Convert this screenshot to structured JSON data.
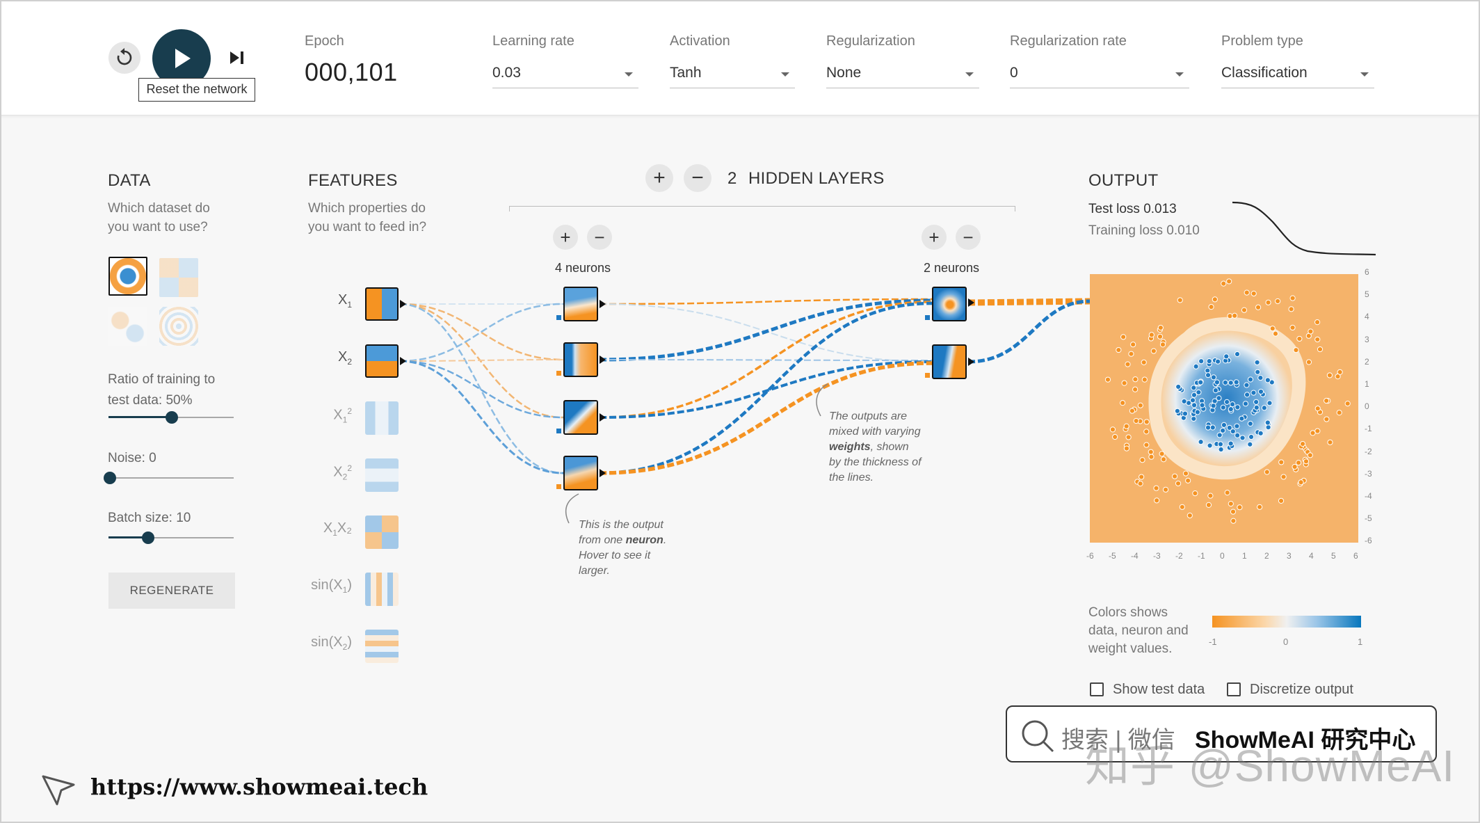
{
  "controls": {
    "reset_tooltip": "Reset the network",
    "reset_icon": "reset-icon",
    "play_icon": "play-icon",
    "step_icon": "step-icon"
  },
  "params": {
    "epoch_label": "Epoch",
    "epoch_value": "000,101",
    "learning_rate_label": "Learning rate",
    "learning_rate_value": "0.03",
    "activation_label": "Activation",
    "activation_value": "Tanh",
    "regularization_label": "Regularization",
    "regularization_value": "None",
    "regularization_rate_label": "Regularization rate",
    "regularization_rate_value": "0",
    "problem_type_label": "Problem type",
    "problem_type_value": "Classification"
  },
  "data_panel": {
    "title": "DATA",
    "subtitle_line1": "Which dataset do",
    "subtitle_line2": "you want to use?",
    "ratio_line1": "Ratio of training to",
    "ratio_line2": "test data:  50%",
    "ratio_value": 0.5,
    "noise_label": "Noise:  0",
    "noise_value": 0,
    "batch_label": "Batch size:  10",
    "batch_value": 0.3,
    "regenerate_label": "REGENERATE"
  },
  "features_panel": {
    "title": "FEATURES",
    "subtitle_line1": "Which properties do",
    "subtitle_line2": "you want to feed in?",
    "features": [
      {
        "base": "X",
        "sub": "1",
        "sup": "",
        "suffix": ""
      },
      {
        "base": "X",
        "sub": "2",
        "sup": "",
        "suffix": ""
      },
      {
        "base": "X",
        "sub": "1",
        "sup": "2",
        "suffix": ""
      },
      {
        "base": "X",
        "sub": "2",
        "sup": "2",
        "suffix": ""
      },
      {
        "base": "X",
        "sub": "1",
        "sup": "",
        "suffix": "X₂"
      },
      {
        "base": "sin(X",
        "sub": "1",
        "sup": "",
        "suffix": ")"
      },
      {
        "base": "sin(X",
        "sub": "2",
        "sup": "",
        "suffix": ")"
      }
    ]
  },
  "network": {
    "hidden_count": "2",
    "hidden_label": "HIDDEN LAYERS",
    "layer1_neurons": "4 neurons",
    "layer2_neurons": "2 neurons",
    "plus_symbol": "+",
    "minus_symbol": "−",
    "annot_neuron_l1": "This is the output",
    "annot_neuron_l2a": "from one ",
    "annot_neuron_l2b": "neuron",
    "annot_neuron_l2c": ".",
    "annot_neuron_l3": "Hover to see it",
    "annot_neuron_l4": "larger.",
    "annot_weights_l1": "The outputs are",
    "annot_weights_l2": "mixed with varying",
    "annot_weights_l3a": "weights",
    "annot_weights_l3b": ", shown",
    "annot_weights_l4": "by the thickness of",
    "annot_weights_l5": "the lines."
  },
  "output_panel": {
    "title": "OUTPUT",
    "test_loss": "Test loss 0.013",
    "training_loss": "Training loss 0.010",
    "y_ticks": [
      "6",
      "5",
      "4",
      "3",
      "2",
      "1",
      "0",
      "-1",
      "-2",
      "-3",
      "-4",
      "-5",
      "-6"
    ],
    "x_ticks": [
      "-6",
      "-5",
      "-4",
      "-3",
      "-2",
      "-1",
      "0",
      "1",
      "2",
      "3",
      "4",
      "5",
      "6"
    ],
    "legend_line1": "Colors shows",
    "legend_line2": "data, neuron and",
    "legend_line3": "weight values.",
    "legend_min": "-1",
    "legend_mid": "0",
    "legend_max": "1",
    "show_test_label": "Show test data",
    "discretize_label": "Discretize output"
  },
  "colors": {
    "orange": "#f59322",
    "blue": "#0877bd",
    "dark": "#183d4e"
  },
  "branding": {
    "search_text": "搜索 | 微信",
    "brand_name": "ShowMeAI 研究中心",
    "watermark": "知乎 @ShowMeAI",
    "url": "https://www.showmeai.tech",
    "search_icon": "search-icon",
    "cursor_icon": "cursor-icon"
  }
}
